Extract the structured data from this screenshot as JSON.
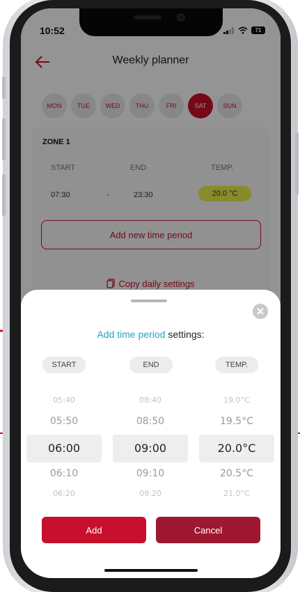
{
  "status": {
    "time": "10:52",
    "battery": "71"
  },
  "header": {
    "title": "Weekly planner"
  },
  "days": [
    {
      "label": "MON",
      "active": false
    },
    {
      "label": "TUE",
      "active": false
    },
    {
      "label": "WED",
      "active": false
    },
    {
      "label": "THU",
      "active": false
    },
    {
      "label": "FRI",
      "active": false
    },
    {
      "label": "SAT",
      "active": true
    },
    {
      "label": "SUN",
      "active": false
    }
  ],
  "zone": {
    "title": "ZONE 1",
    "columns": {
      "start": "START",
      "end": "END",
      "temp": "TEMP."
    },
    "row": {
      "start": "07:30",
      "sep": "-",
      "end": "23:30",
      "temp": "20.0 °C"
    },
    "add_period": "Add new time period",
    "copy_settings": "Copy daily settings"
  },
  "sheet": {
    "title_highlight": "Add time period",
    "title_rest": " settings:",
    "columns": {
      "start": "START",
      "end": "END",
      "temp": "TEMP."
    },
    "start_values": [
      "05:40",
      "05:50",
      "06:00",
      "06:10",
      "06:20"
    ],
    "end_values": [
      "08:40",
      "08:50",
      "09:00",
      "09:10",
      "09:20"
    ],
    "temp_values": [
      "19.0°C",
      "19.5°C",
      "20.0°C",
      "20.5°C",
      "21.0°C"
    ],
    "add_label": "Add",
    "cancel_label": "Cancel"
  },
  "colors": {
    "accent": "#c8102e",
    "highlight": "#1ba6c9",
    "temp_pill": "#e9f04a"
  }
}
